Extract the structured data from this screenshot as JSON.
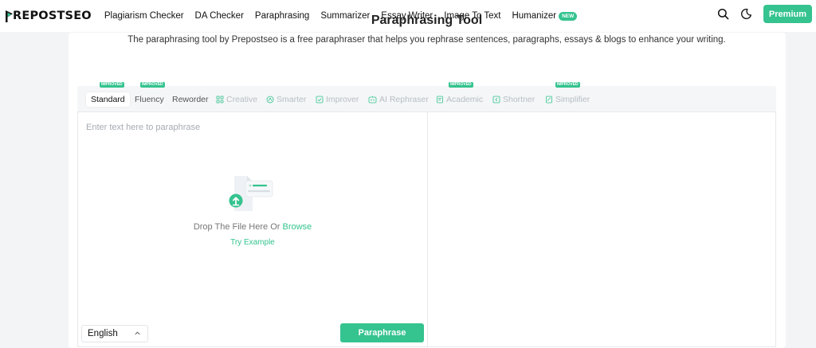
{
  "brand": {
    "logo_text": "REPOSTSEO",
    "logo_text_full": "PREPOSTSEO",
    "accent_color": "#35c38f"
  },
  "nav": {
    "items": [
      {
        "label": "Plagiarism Checker"
      },
      {
        "label": "DA Checker"
      },
      {
        "label": "Paraphrasing"
      },
      {
        "label": "Summarizer"
      },
      {
        "label": "Essay Writer"
      },
      {
        "label": "Image To Text"
      },
      {
        "label": "Humanizer",
        "badge": "NEW"
      }
    ],
    "search_icon": "search-icon",
    "theme_icon": "moon-icon",
    "premium_label": "Premium"
  },
  "page": {
    "title": "Paraphrasing Tool",
    "subtitle": "The paraphrasing tool by Prepostseo is a free paraphraser that helps you rephrase sentences, paragraphs, essays & blogs to enhance your writing."
  },
  "modes": [
    {
      "label": "Standard",
      "badge": "IMPROVED",
      "state": "active"
    },
    {
      "label": "Fluency",
      "badge": "IMPROVED",
      "state": "enabled"
    },
    {
      "label": "Reworder",
      "state": "enabled"
    },
    {
      "label": "Creative",
      "icon": "creative-icon",
      "state": "locked"
    },
    {
      "label": "Smarter",
      "icon": "smarter-icon",
      "state": "locked"
    },
    {
      "label": "Improver",
      "icon": "improver-icon",
      "state": "locked"
    },
    {
      "label": "AI Rephraser",
      "icon": "ai-rephraser-icon",
      "state": "locked"
    },
    {
      "label": "Academic",
      "icon": "academic-icon",
      "badge": "IMPROVED",
      "state": "locked"
    },
    {
      "label": "Shortner",
      "icon": "shortner-icon",
      "state": "locked"
    },
    {
      "label": "Simplifier",
      "icon": "simplifier-icon",
      "badge": "IMPROVED",
      "state": "locked"
    }
  ],
  "editor": {
    "placeholder": "Enter text here to paraphrase",
    "drop_text": "Drop The File Here Or ",
    "browse_label": "Browse",
    "try_example_label": "Try Example",
    "language": "English",
    "paraphrase_label": "Paraphrase"
  }
}
